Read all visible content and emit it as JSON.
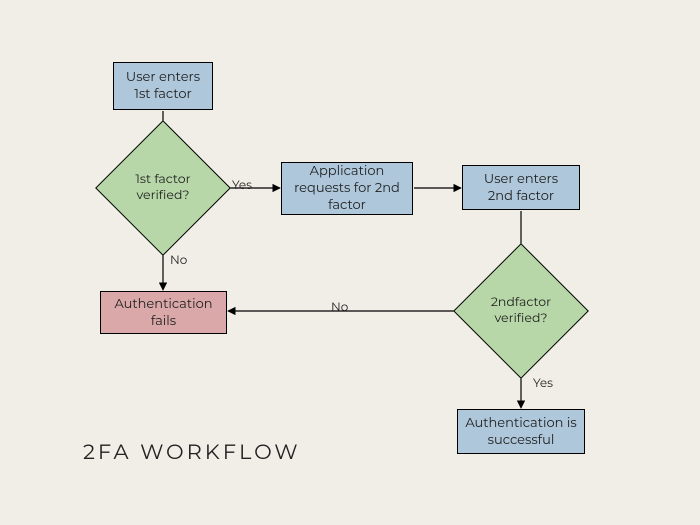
{
  "title": "2FA WORKFLOW",
  "nodes": {
    "enter1": "User enters\n1st factor",
    "verify1": "1st factor\nverified?",
    "request2": "Application\nrequests for 2nd\nfactor",
    "enter2": "User enters\n2nd factor",
    "fail": "Authentication\nfails",
    "verify2": "2ndfactor\nverified?",
    "success": "Authentication is\nsuccessful"
  },
  "edges": {
    "v1_yes": "Yes",
    "v1_no": "No",
    "v2_yes": "Yes",
    "v2_no": "No"
  },
  "colors": {
    "bg": "#f1eee8",
    "blue": "#aec7da",
    "green": "#b7d7a8",
    "pink": "#daa8a8"
  }
}
